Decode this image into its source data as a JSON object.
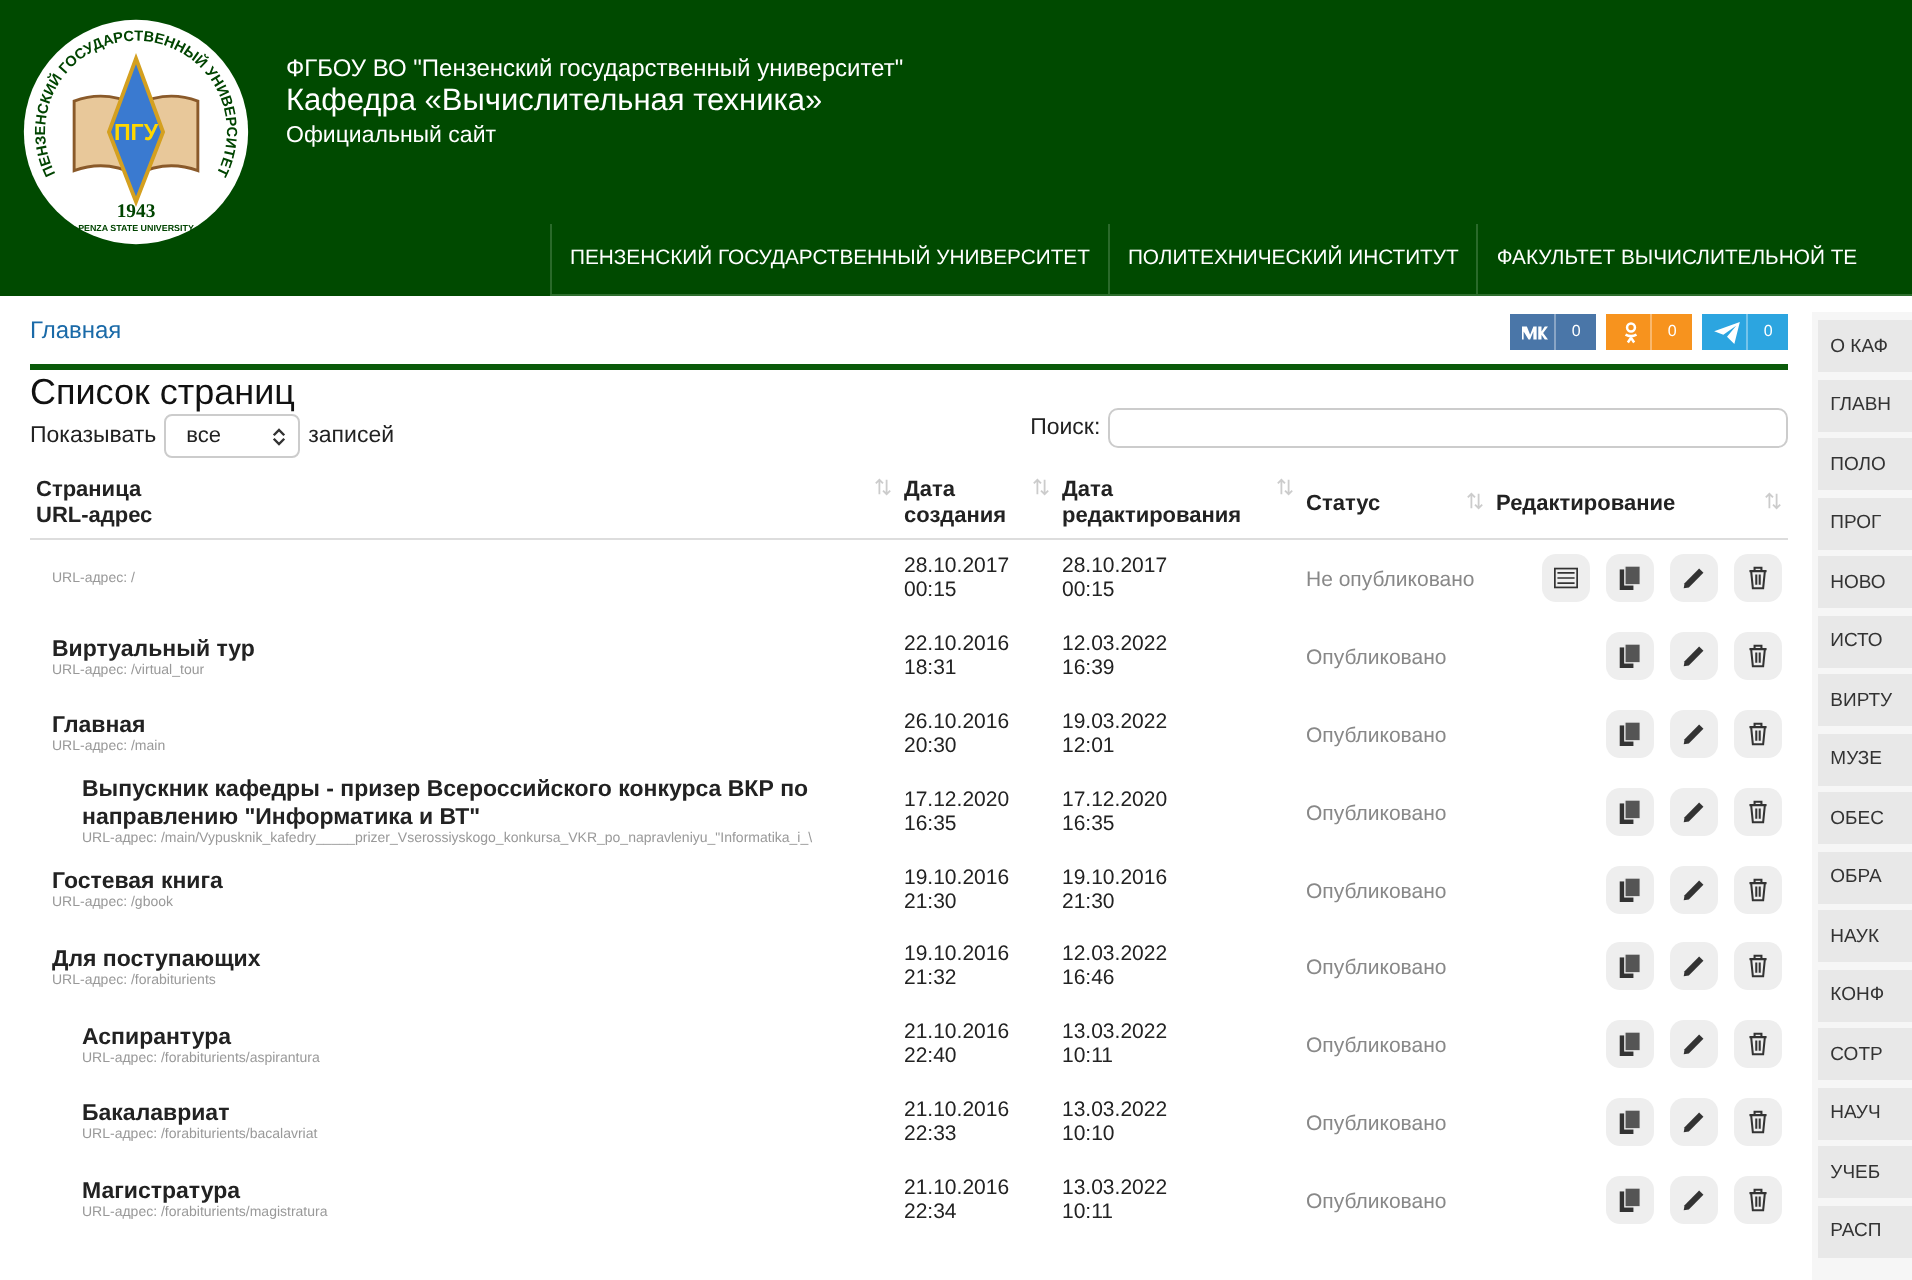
{
  "header": {
    "logo": {
      "ring_text": "ПЕНЗЕНСКИЙ ГОСУДАРСТВЕННЫЙ УНИВЕРСИТЕТ",
      "abbr": "ПГУ",
      "year": "1943",
      "caption": "PENZA STATE UNIVERSITY"
    },
    "org": "ФГБОУ ВО \"Пензенский государственный университет\"",
    "title": "Кафедра «Вычислительная техника»",
    "subtitle": "Официальный сайт"
  },
  "nav": [
    "ПЕНЗЕНСКИЙ ГОСУДАРСТВЕННЫЙ УНИВЕРСИТЕТ",
    "ПОЛИТЕХНИЧЕСКИЙ ИНСТИТУТ",
    "ФАКУЛЬТЕТ ВЫЧИСЛИТЕЛЬНОЙ ТЕ"
  ],
  "breadcrumb": "Главная",
  "share": [
    {
      "kind": "vk",
      "count": "0",
      "color": "#4a76a8"
    },
    {
      "kind": "ok",
      "count": "0",
      "color": "#f7931e"
    },
    {
      "kind": "telegram",
      "count": "0",
      "color": "#2ca5e0"
    }
  ],
  "heading": "Список страниц",
  "length": {
    "before": "Показывать",
    "value": "все",
    "after": "записей"
  },
  "search": {
    "label": "Поиск:"
  },
  "table": {
    "columns": [
      {
        "lines": [
          "Страница",
          "URL-адрес"
        ]
      },
      {
        "lines": [
          "Дата",
          "создания"
        ]
      },
      {
        "lines": [
          "Дата",
          "редактирования"
        ]
      },
      {
        "lines": [
          "Статус"
        ]
      },
      {
        "lines": [
          "Редактирование"
        ]
      }
    ],
    "rows": [
      {
        "title": "",
        "url": "URL-адрес: /",
        "created": [
          "28.10.2017",
          "00:15"
        ],
        "edited": [
          "28.10.2017",
          "00:15"
        ],
        "status": "Не опубликовано",
        "list_button": true
      },
      {
        "title": "Виртуальный тур",
        "url": "URL-адрес: /virtual_tour",
        "created": [
          "22.10.2016",
          "18:31"
        ],
        "edited": [
          "12.03.2022",
          "16:39"
        ],
        "status": "Опубликовано",
        "list_button": false
      },
      {
        "title": "Главная",
        "url": "URL-адрес: /main",
        "created": [
          "26.10.2016",
          "20:30"
        ],
        "edited": [
          "19.03.2022",
          "12:01"
        ],
        "status": "Опубликовано",
        "list_button": false,
        "children": [
          {
            "title": "Выпускник кафедры - призер Всероссийского конкурса ВКР по направлению \"Информатика и ВТ\"",
            "url": "URL-адрес: /main/Vypusknik_kafedry_____prizer_Vserossiyskogo_konkursa_VKR_po_napravleniyu_\"Informatika_i_\\",
            "created": [
              "17.12.2020",
              "16:35"
            ],
            "edited": [
              "17.12.2020",
              "16:35"
            ],
            "status": "Опубликовано",
            "list_button": false
          }
        ]
      },
      {
        "title": "Гостевая книга",
        "url": "URL-адрес: /gbook",
        "created": [
          "19.10.2016",
          "21:30"
        ],
        "edited": [
          "19.10.2016",
          "21:30"
        ],
        "status": "Опубликовано",
        "list_button": false
      },
      {
        "title": "Для поступающих",
        "url": "URL-адрес: /forabiturients",
        "created": [
          "19.10.2016",
          "21:32"
        ],
        "edited": [
          "12.03.2022",
          "16:46"
        ],
        "status": "Опубликовано",
        "list_button": false,
        "children": [
          {
            "title": "Аспирантура",
            "url": "URL-адрес: /forabiturients/aspirantura",
            "created": [
              "21.10.2016",
              "22:40"
            ],
            "edited": [
              "13.03.2022",
              "10:11"
            ],
            "status": "Опубликовано",
            "list_button": false
          },
          {
            "title": "Бакалавриат",
            "url": "URL-адрес: /forabiturients/bacalavriat",
            "created": [
              "21.10.2016",
              "22:33"
            ],
            "edited": [
              "13.03.2022",
              "10:10"
            ],
            "status": "Опубликовано",
            "list_button": false
          },
          {
            "title": "Магистратура",
            "url": "URL-адрес: /forabiturients/magistratura",
            "created": [
              "21.10.2016",
              "22:34"
            ],
            "edited": [
              "13.03.2022",
              "10:11"
            ],
            "status": "Опубликовано",
            "list_button": false
          }
        ]
      }
    ]
  },
  "sidebar": [
    "О КАФ",
    "ГЛАВН",
    "ПОЛО",
    "ПРОГ",
    "НОВО",
    "ИСТО",
    "ВИРТУ",
    "МУЗЕ",
    "ОБЕС",
    "ОБРА",
    "НАУК",
    "КОНФ",
    "СОТР",
    "НАУЧ",
    "УЧЕБ",
    "РАСП"
  ]
}
